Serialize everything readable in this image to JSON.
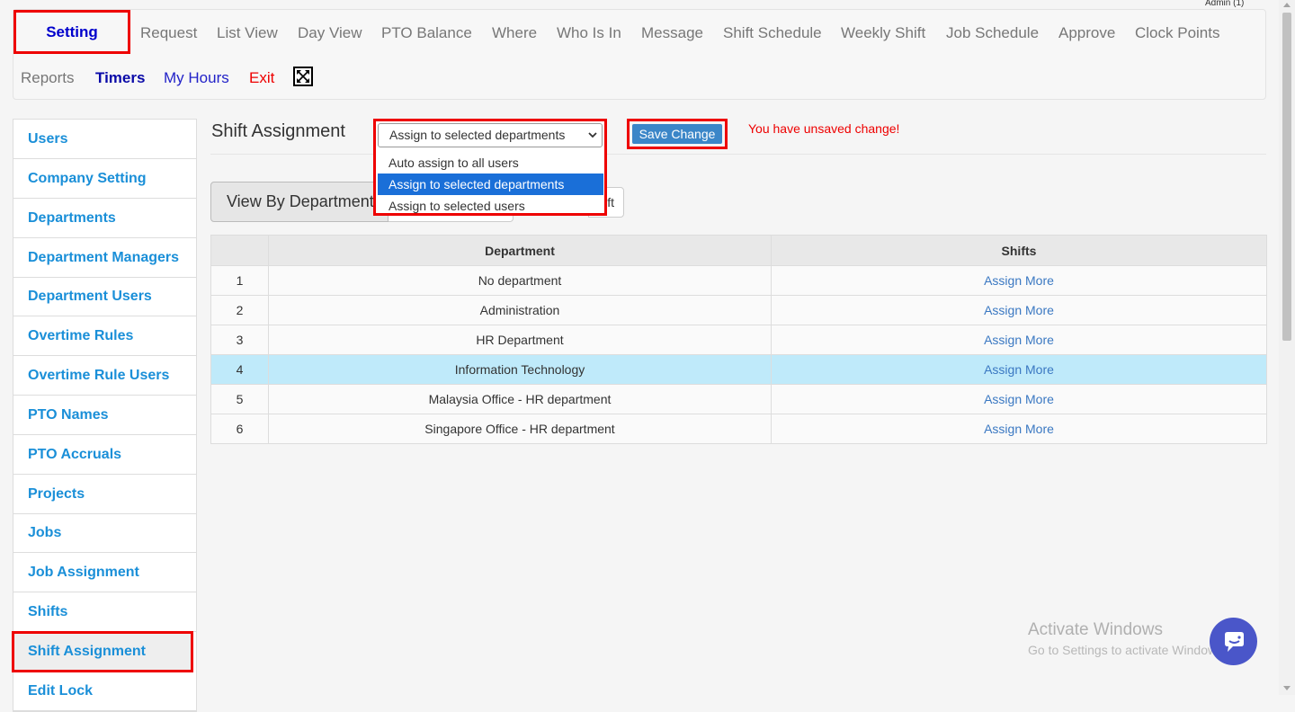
{
  "header": {
    "admin_label": "Admin (1)"
  },
  "nav": {
    "setting": "Setting",
    "items": [
      "Request",
      "List View",
      "Day View",
      "PTO Balance",
      "Where",
      "Who Is In",
      "Message",
      "Shift Schedule",
      "Weekly Shift",
      "Job Schedule",
      "Approve",
      "Clock Points"
    ],
    "reports": "Reports",
    "timers": "Timers",
    "my_hours": "My Hours",
    "exit": "Exit"
  },
  "sidebar": {
    "items": [
      "Users",
      "Company Setting",
      "Departments",
      "Department Managers",
      "Department Users",
      "Overtime Rules",
      "Overtime Rule Users",
      "PTO Names",
      "PTO Accruals",
      "Projects",
      "Jobs",
      "Job Assignment",
      "Shifts",
      "Shift Assignment",
      "Edit Lock"
    ],
    "active": "Shift Assignment"
  },
  "main": {
    "title": "Shift Assignment",
    "select": {
      "value": "Assign to selected departments",
      "options": [
        "Auto assign to all users",
        "Assign to selected departments",
        "Assign to selected users"
      ]
    },
    "save_label": "Save Change",
    "unsaved": "You have unsaved change!",
    "tabs": {
      "by_department": "View By Department",
      "by_shift_partial": "ft"
    },
    "table": {
      "headers": [
        "",
        "Department",
        "Shifts"
      ],
      "rows": [
        {
          "n": "1",
          "dept": "No department",
          "action": "Assign More"
        },
        {
          "n": "2",
          "dept": "Administration",
          "action": "Assign More"
        },
        {
          "n": "3",
          "dept": "HR Department",
          "action": "Assign More"
        },
        {
          "n": "4",
          "dept": "Information Technology",
          "action": "Assign More"
        },
        {
          "n": "5",
          "dept": "Malaysia Office - HR department",
          "action": "Assign More"
        },
        {
          "n": "6",
          "dept": "Singapore Office - HR department",
          "action": "Assign More"
        }
      ]
    }
  },
  "watermark": {
    "line1": "Activate Windows",
    "line2": "Go to Settings to activate Windows."
  },
  "colors": {
    "accent": "#1a8fd8",
    "danger": "#e00000",
    "selected": "#1a6fd8",
    "highlight_row": "#bfeafa"
  }
}
